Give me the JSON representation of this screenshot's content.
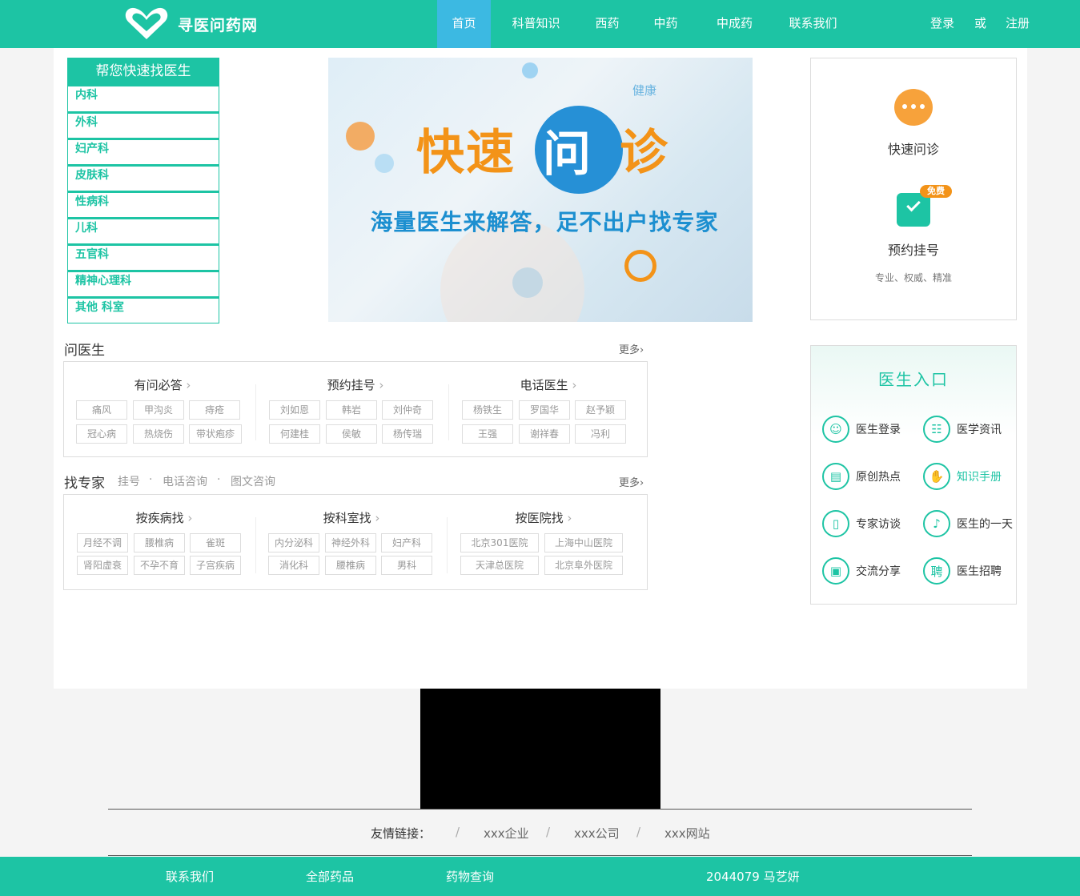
{
  "header": {
    "logo_text": "寻医问药网",
    "nav": [
      "首页",
      "科普知识",
      "西药",
      "中药",
      "中成药",
      "联系我们"
    ],
    "login": "登录",
    "or": "或",
    "register": "注册"
  },
  "departments": {
    "title": "帮您快速找医生",
    "items": [
      "内科",
      "外科",
      "妇产科",
      "皮肤科",
      "性病科",
      "儿科",
      "五官科",
      "精神心理科",
      "其他  科室"
    ]
  },
  "banner": {
    "title_left": "快速",
    "title_bubble": "问",
    "title_right": "诊",
    "subtitle": "海量医生来解答，足不出户找专家",
    "tag": "健康"
  },
  "quick_panel": {
    "consult_label": "快速问诊",
    "booking_label": "预约挂号",
    "booking_badge": "免费",
    "booking_sub": "专业、权威、精准"
  },
  "ask_doctor": {
    "title": "问医生",
    "more": "更多",
    "columns": [
      {
        "title": "有问必答",
        "chips": [
          "痛风",
          "甲沟炎",
          "痔疮",
          "冠心病",
          "热烧伤",
          "带状疱疹"
        ]
      },
      {
        "title": "预约挂号",
        "chips": [
          "刘如恩",
          "韩岩",
          "刘仲奇",
          "何建桂",
          "侯敏",
          "杨传瑞"
        ]
      },
      {
        "title": "电话医生",
        "chips": [
          "杨铁生",
          "罗国华",
          "赵予颖",
          "王强",
          "谢祥春",
          "冯利"
        ]
      }
    ]
  },
  "find_expert": {
    "title": "找专家",
    "subs": [
      "挂号",
      "·",
      "电话咨询",
      "·",
      "图文咨询"
    ],
    "more": "更多",
    "columns": [
      {
        "title": "按疾病找",
        "chips": [
          "月经不调",
          "腰椎病",
          "雀斑",
          "肾阳虚衰",
          "不孕不育",
          "子宫疾病"
        ]
      },
      {
        "title": "按科室找",
        "chips": [
          "内分泌科",
          "神经外科",
          "妇产科",
          "消化科",
          "腰椎病",
          "男科"
        ]
      },
      {
        "title": "按医院找",
        "chips": [
          "北京301医院",
          "上海中山医院",
          "天津总医院",
          "北京阜外医院"
        ]
      }
    ]
  },
  "doctor_entry": {
    "title": "医生入口",
    "items": [
      {
        "label": "医生登录",
        "icon": "doctor-icon",
        "glyph": "☺"
      },
      {
        "label": "医学资讯",
        "icon": "news-icon",
        "glyph": "☷"
      },
      {
        "label": "原创热点",
        "icon": "article-icon",
        "glyph": "▤"
      },
      {
        "label": "知识手册",
        "icon": "hand-icon",
        "glyph": "✋"
      },
      {
        "label": "专家访谈",
        "icon": "book-icon",
        "glyph": "▯"
      },
      {
        "label": "医生的一天",
        "icon": "mic-icon",
        "glyph": "♪"
      },
      {
        "label": "交流分享",
        "icon": "image-icon",
        "glyph": "▣"
      },
      {
        "label": "医生招聘",
        "icon": "recruit-icon",
        "glyph": "聘"
      }
    ]
  },
  "friend_links": {
    "label": "友情链接：",
    "sep": "/",
    "items": [
      "xxx企业",
      "xxx公司",
      "xxx网站"
    ]
  },
  "footer": {
    "items": [
      "联系我们",
      "全部药品",
      "药物查询",
      "2044079  马艺妍"
    ]
  },
  "colors": {
    "brand": "#1dc4a4",
    "nav_active": "#3cb9e2",
    "banner_orange": "#f39318",
    "banner_blue": "#2690d6"
  }
}
